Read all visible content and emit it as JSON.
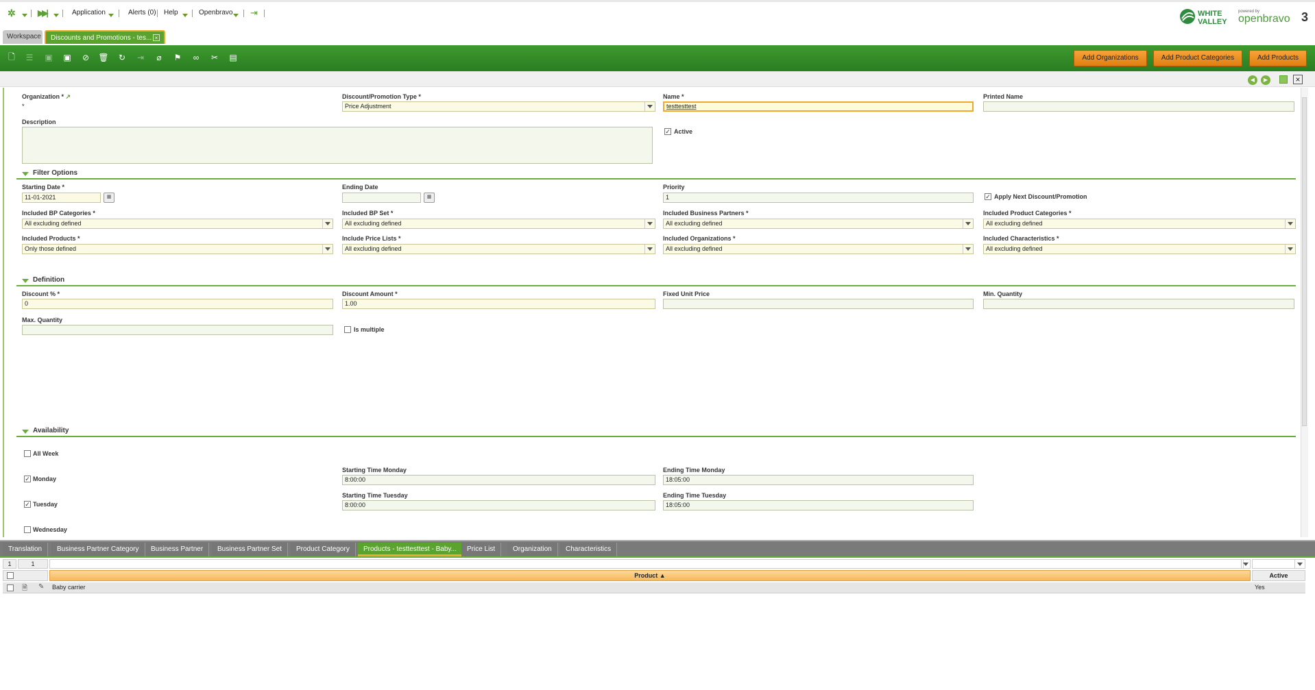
{
  "topnav": {
    "application": "Application",
    "alerts": "Alerts (0)",
    "help": "Help",
    "user": "Openbravo"
  },
  "logos": {
    "white_valley": "WHITE VALLEY",
    "powered_by": "powered by",
    "openbravo": "openbravo"
  },
  "tabs": {
    "workspace": "Workspace",
    "active": "Discounts and Promotions - tes..."
  },
  "toolbar": {
    "icons": [
      "new-document",
      "new-row",
      "save",
      "save-close",
      "undo",
      "delete",
      "refresh",
      "export",
      "attach",
      "audit",
      "link",
      "tools",
      "grid-toggle"
    ],
    "add_organizations": "Add Organizations",
    "add_product_categories": "Add Product Categories",
    "add_products": "Add Products"
  },
  "form": {
    "organization": {
      "label": "Organization *",
      "value": "*"
    },
    "promotion_type": {
      "label": "Discount/Promotion Type *",
      "value": "Price Adjustment"
    },
    "name": {
      "label": "Name *",
      "value": "testtesttest"
    },
    "printed_name": {
      "label": "Printed Name",
      "value": ""
    },
    "description": {
      "label": "Description",
      "value": ""
    },
    "active": {
      "label": "Active",
      "checked": true
    },
    "filter_options": {
      "title": "Filter Options",
      "starting_date": {
        "label": "Starting Date *",
        "value": "11-01-2021"
      },
      "ending_date": {
        "label": "Ending Date",
        "value": ""
      },
      "priority": {
        "label": "Priority",
        "value": "1"
      },
      "apply_next": {
        "label": "Apply Next Discount/Promotion",
        "checked": true
      },
      "bp_categories": {
        "label": "Included BP Categories *",
        "value": "All excluding defined"
      },
      "bp_set": {
        "label": "Included BP Set *",
        "value": "All excluding defined"
      },
      "business_partners": {
        "label": "Included Business Partners *",
        "value": "All excluding defined"
      },
      "product_categories": {
        "label": "Included Product Categories *",
        "value": "All excluding defined"
      },
      "products": {
        "label": "Included Products *",
        "value": "Only those defined"
      },
      "price_lists": {
        "label": "Include Price Lists *",
        "value": "All excluding defined"
      },
      "organizations": {
        "label": "Included Organizations *",
        "value": "All excluding defined"
      },
      "characteristics": {
        "label": "Included Characteristics *",
        "value": "All excluding defined"
      }
    },
    "definition": {
      "title": "Definition",
      "discount_pct": {
        "label": "Discount % *",
        "value": "0"
      },
      "discount_amount": {
        "label": "Discount Amount *",
        "value": "1.00"
      },
      "fixed_unit_price": {
        "label": "Fixed Unit Price",
        "value": ""
      },
      "min_quantity": {
        "label": "Min. Quantity",
        "value": ""
      },
      "max_quantity": {
        "label": "Max. Quantity",
        "value": ""
      },
      "is_multiple": {
        "label": "Is multiple",
        "checked": false
      }
    },
    "availability": {
      "title": "Availability",
      "all_week": {
        "label": "All Week",
        "checked": false
      },
      "monday": {
        "label": "Monday",
        "checked": true
      },
      "tuesday": {
        "label": "Tuesday",
        "checked": true
      },
      "wednesday": {
        "label": "Wednesday",
        "checked": false
      },
      "start_monday": {
        "label": "Starting Time Monday",
        "value": "8:00:00"
      },
      "end_monday": {
        "label": "Ending Time Monday",
        "value": "18:05:00"
      },
      "start_tuesday": {
        "label": "Starting Time Tuesday",
        "value": "8:00:00"
      },
      "end_tuesday": {
        "label": "Ending Time Tuesday",
        "value": "18:05:00"
      }
    }
  },
  "subtabs": [
    "Translation",
    "Business Partner Category",
    "Business Partner",
    "Business Partner Set",
    "Product Category",
    "Products - testtesttest - Baby...",
    "Price List",
    "Organization",
    "Characteristics"
  ],
  "grid": {
    "page_from": "1",
    "page_count": "1",
    "columns": {
      "product": "Product",
      "active": "Active"
    },
    "rows": [
      {
        "product": "Baby carrier",
        "active": "Yes"
      }
    ]
  },
  "colors": {
    "green": "#5aa32f",
    "orange": "#f0a830"
  }
}
